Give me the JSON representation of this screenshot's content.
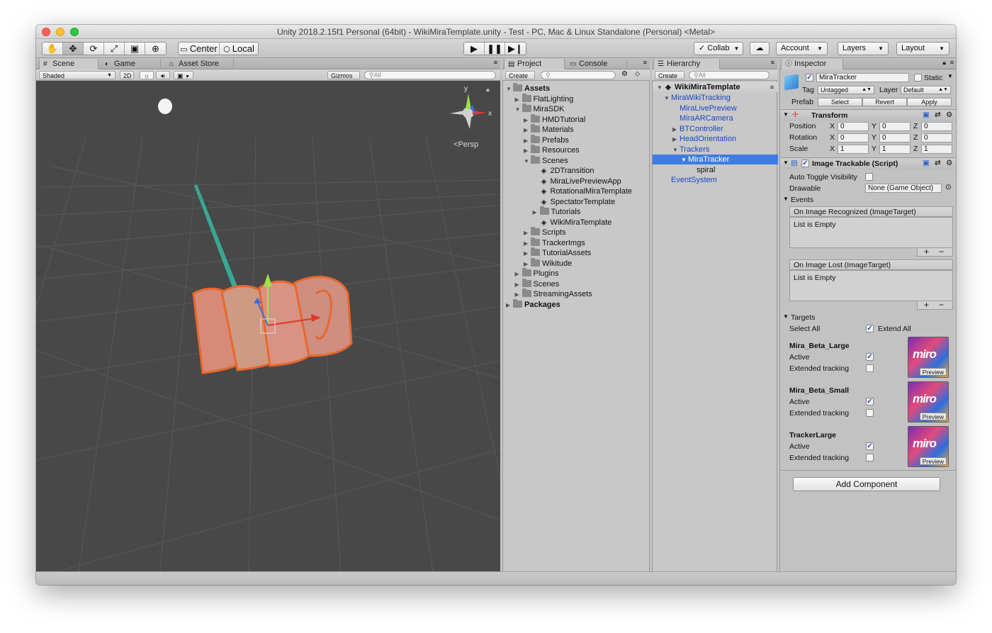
{
  "window": {
    "title": "Unity 2018.2.15f1 Personal (64bit) - WikiMiraTemplate.unity - Test - PC, Mac & Linux Standalone (Personal) <Metal>"
  },
  "toolbar": {
    "tools": [
      "hand-tool",
      "move-tool",
      "rotate-tool",
      "scale-tool",
      "rect-tool",
      "transform-tool"
    ],
    "pivot_label": "Center",
    "space_label": "Local",
    "collab_label": "Collab",
    "account_label": "Account",
    "layers_label": "Layers",
    "layout_label": "Layout"
  },
  "scene_panel": {
    "tabs": [
      "Scene",
      "Game",
      "Asset Store"
    ],
    "shading_mode": "Shaded",
    "mode_2d": "2D",
    "gizmos_label": "Gizmos",
    "search_placeholder": "All",
    "persp_label": "Persp",
    "gizmo_axes": {
      "y": "y",
      "x": "x"
    }
  },
  "project_panel": {
    "tabs": [
      "Project",
      "Console"
    ],
    "create_label": "Create",
    "items": [
      {
        "label": "Assets",
        "depth": 0,
        "expanded": true,
        "bold": true
      },
      {
        "label": "FlatLighting",
        "depth": 1,
        "expanded": false
      },
      {
        "label": "MiraSDK",
        "depth": 1,
        "expanded": true
      },
      {
        "label": "HMDTutorial",
        "depth": 2,
        "expanded": false
      },
      {
        "label": "Materials",
        "depth": 2,
        "expanded": false
      },
      {
        "label": "Prefabs",
        "depth": 2,
        "expanded": false
      },
      {
        "label": "Resources",
        "depth": 2,
        "expanded": false
      },
      {
        "label": "Scenes",
        "depth": 2,
        "expanded": true
      },
      {
        "label": "2DTransition",
        "depth": 3,
        "scene": true
      },
      {
        "label": "MiraLivePreviewApp",
        "depth": 3,
        "scene": true
      },
      {
        "label": "RotationalMiraTemplate",
        "depth": 3,
        "scene": true
      },
      {
        "label": "SpectatorTemplate",
        "depth": 3,
        "scene": true
      },
      {
        "label": "Tutorials",
        "depth": 3,
        "expanded": false
      },
      {
        "label": "WikiMiraTemplate",
        "depth": 3,
        "scene": true
      },
      {
        "label": "Scripts",
        "depth": 2,
        "expanded": false
      },
      {
        "label": "TrackerImgs",
        "depth": 2,
        "expanded": false
      },
      {
        "label": "TutorialAssets",
        "depth": 2,
        "expanded": false
      },
      {
        "label": "Wikitude",
        "depth": 2,
        "expanded": false
      },
      {
        "label": "Plugins",
        "depth": 1,
        "expanded": false
      },
      {
        "label": "Scenes",
        "depth": 1,
        "expanded": false
      },
      {
        "label": "StreamingAssets",
        "depth": 1,
        "expanded": false
      },
      {
        "label": "Packages",
        "depth": 0,
        "expanded": false,
        "bold": true
      }
    ]
  },
  "hierarchy_panel": {
    "tab": "Hierarchy",
    "create_label": "Create",
    "search_placeholder": "All",
    "scene_name": "WikiMiraTemplate",
    "items": [
      {
        "label": "MiraWikiTracking",
        "depth": 1,
        "arrow": "down"
      },
      {
        "label": "MiraLivePreview",
        "depth": 2,
        "arrow": ""
      },
      {
        "label": "MiraARCamera",
        "depth": 2,
        "arrow": ""
      },
      {
        "label": "BTController",
        "depth": 2,
        "arrow": "right"
      },
      {
        "label": "HeadOrientation",
        "depth": 2,
        "arrow": "right"
      },
      {
        "label": "Trackers",
        "depth": 2,
        "arrow": "down"
      },
      {
        "label": "MiraTracker",
        "depth": 3,
        "arrow": "down",
        "selected": true
      },
      {
        "label": "spiral",
        "depth": 4,
        "arrow": "",
        "plain": true
      },
      {
        "label": "EventSystem",
        "depth": 1,
        "arrow": ""
      }
    ]
  },
  "inspector": {
    "tab": "Inspector",
    "object_name": "MiraTracker",
    "static_label": "Static",
    "tag_label": "Tag",
    "tag_value": "Untagged",
    "layer_label": "Layer",
    "layer_value": "Default",
    "prefab_label": "Prefab",
    "prefab_buttons": [
      "Select",
      "Revert",
      "Apply"
    ],
    "transform": {
      "title": "Transform",
      "rows": [
        {
          "label": "Position",
          "x": "0",
          "y": "0",
          "z": "0"
        },
        {
          "label": "Rotation",
          "x": "0",
          "y": "0",
          "z": "0"
        },
        {
          "label": "Scale",
          "x": "1",
          "y": "1",
          "z": "1"
        }
      ],
      "axis_x": "X",
      "axis_y": "Y",
      "axis_z": "Z"
    },
    "script": {
      "title": "Image Trackable (Script)",
      "auto_toggle_label": "Auto Toggle Visibility",
      "drawable_label": "Drawable",
      "drawable_value": "None (Game Object)",
      "events_label": "Events",
      "event1_title": "On Image Recognized (ImageTarget)",
      "event1_body": "List is Empty",
      "event2_title": "On Image Lost (ImageTarget)",
      "event2_body": "List is Empty",
      "plus": "+",
      "minus": "−",
      "targets_label": "Targets",
      "select_all_label": "Select All",
      "extend_all_label": "Extend All",
      "targets": [
        {
          "name": "Mira_Beta_Large",
          "active_label": "Active",
          "extended_label": "Extended tracking",
          "preview": "Preview",
          "logo": "miro"
        },
        {
          "name": "Mira_Beta_Small",
          "active_label": "Active",
          "extended_label": "Extended tracking",
          "preview": "Preview",
          "logo": "miro"
        },
        {
          "name": "TrackerLarge",
          "active_label": "Active",
          "extended_label": "Extended tracking",
          "preview": "Preview",
          "logo": "miro"
        }
      ]
    },
    "add_component_label": "Add Component"
  },
  "colors": {
    "selection": "#3e7ce4",
    "scene_bg": "#484848",
    "accent_orange": "#e8672c"
  }
}
